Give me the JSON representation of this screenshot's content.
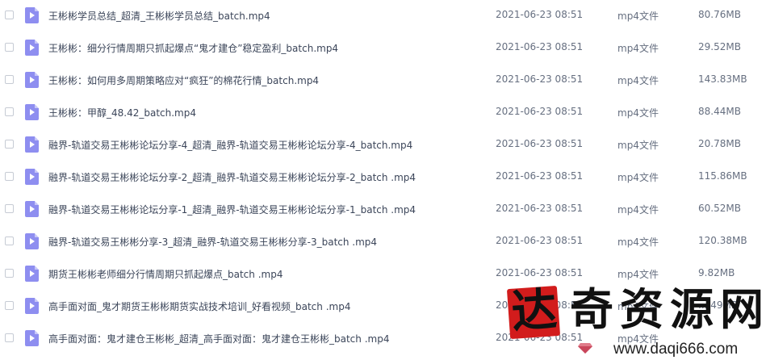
{
  "files": [
    {
      "name": "王彬彬学员总结_超清_王彬彬学员总结_batch.mp4",
      "date": "2021-06-23 08:51",
      "type": "mp4文件",
      "size": "80.76MB"
    },
    {
      "name": "王彬彬：细分行情周期只抓起爆点“鬼才建仓”稳定盈利_batch.mp4",
      "date": "2021-06-23 08:51",
      "type": "mp4文件",
      "size": "29.52MB"
    },
    {
      "name": "王彬彬：如何用多周期策略应对“疯狂”的棉花行情_batch.mp4",
      "date": "2021-06-23 08:51",
      "type": "mp4文件",
      "size": "143.83MB"
    },
    {
      "name": "王彬彬：甲醇_48.42_batch.mp4",
      "date": "2021-06-23 08:51",
      "type": "mp4文件",
      "size": "88.44MB"
    },
    {
      "name": "融界-轨道交易王彬彬论坛分享-4_超清_融界-轨道交易王彬彬论坛分享-4_batch.mp4",
      "date": "2021-06-23 08:51",
      "type": "mp4文件",
      "size": "20.78MB"
    },
    {
      "name": "融界-轨道交易王彬彬论坛分享-2_超清_融界-轨道交易王彬彬论坛分享-2_batch .mp4",
      "date": "2021-06-23 08:51",
      "type": "mp4文件",
      "size": "115.86MB"
    },
    {
      "name": "融界-轨道交易王彬彬论坛分享-1_超清_融界-轨道交易王彬彬论坛分享-1_batch .mp4",
      "date": "2021-06-23 08:51",
      "type": "mp4文件",
      "size": "60.52MB"
    },
    {
      "name": "融界-轨道交易王彬彬分享-3_超清_融界-轨道交易王彬彬分享-3_batch .mp4",
      "date": "2021-06-23 08:51",
      "type": "mp4文件",
      "size": "120.38MB"
    },
    {
      "name": "期货王彬彬老师细分行情周期只抓起爆点_batch .mp4",
      "date": "2021-06-23 08:51",
      "type": "mp4文件",
      "size": "9.82MB"
    },
    {
      "name": "高手面对面_鬼才期货王彬彬期货实战技术培训_好看视频_batch .mp4",
      "date": "2021-06-23 08:51",
      "type": "mp4文件",
      "size": "....49MB"
    },
    {
      "name": "高手面对面：鬼才建仓王彬彬_超清_高手面对面：鬼才建仓王彬彬_batch .mp4",
      "date": "2021-06-23 08:51",
      "type": "mp4文件",
      "size": ""
    }
  ],
  "watermark": {
    "seal_char": "达",
    "title": "奇资源网",
    "url": "www.daqi666.com"
  },
  "colors": {
    "file_icon": "#8e8ef0",
    "seal": "#d21c1c"
  },
  "icons": {
    "file": "video-file-icon",
    "watermark_gem": "diamond-icon"
  }
}
